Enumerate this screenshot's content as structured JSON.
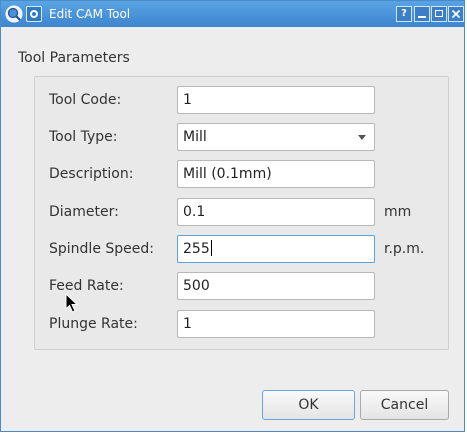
{
  "window": {
    "title": "Edit CAM Tool",
    "help_button": "?"
  },
  "group": {
    "title": "Tool Parameters"
  },
  "fields": [
    {
      "label": "Tool Code:",
      "value": "1",
      "unit": ""
    },
    {
      "label": "Tool Type:",
      "value": "Mill",
      "unit": ""
    },
    {
      "label": "Description:",
      "value": "Mill (0.1mm)",
      "unit": ""
    },
    {
      "label": "Diameter:",
      "value": "0.1",
      "unit": "mm"
    },
    {
      "label": "Spindle Speed:",
      "value": "255",
      "unit": "r.p.m."
    },
    {
      "label": "Feed Rate:",
      "value": "500",
      "unit": ""
    },
    {
      "label": "Plunge Rate:",
      "value": "1",
      "unit": ""
    }
  ],
  "buttons": {
    "ok": "OK",
    "cancel": "Cancel"
  },
  "colors": {
    "titlebar": "#3d86cf",
    "focus": "#5aa3e3"
  }
}
